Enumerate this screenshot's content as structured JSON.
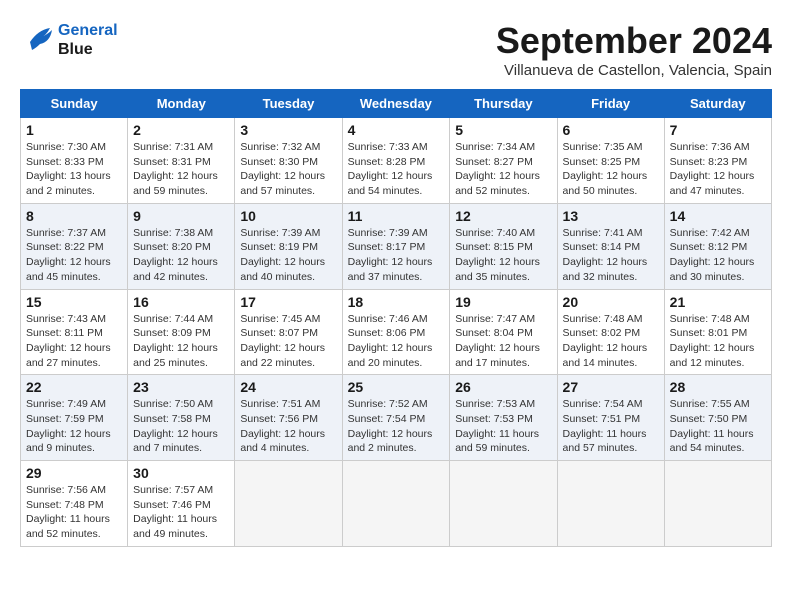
{
  "header": {
    "logo_line1": "General",
    "logo_line2": "Blue",
    "month_title": "September 2024",
    "location": "Villanueva de Castellon, Valencia, Spain"
  },
  "days_of_week": [
    "Sunday",
    "Monday",
    "Tuesday",
    "Wednesday",
    "Thursday",
    "Friday",
    "Saturday"
  ],
  "weeks": [
    {
      "days": [
        {
          "num": "",
          "empty": true
        },
        {
          "num": "",
          "empty": true
        },
        {
          "num": "",
          "empty": true
        },
        {
          "num": "",
          "empty": true
        },
        {
          "num": "",
          "empty": true
        },
        {
          "num": "",
          "empty": true
        },
        {
          "num": "1",
          "sunrise": "Sunrise: 7:36 AM",
          "sunset": "Sunset: 8:23 PM",
          "daylight": "Daylight: 12 hours and 47 minutes."
        }
      ]
    },
    {
      "days": [
        {
          "num": "2",
          "sunrise": "Sunrise: 7:31 AM",
          "sunset": "Sunset: 8:33 PM",
          "daylight": "Daylight: 13 hours and 2 minutes."
        },
        {
          "num": "3",
          "sunrise": "Sunrise: 7:32 AM",
          "sunset": "Sunset: 8:30 PM",
          "daylight": "Daylight: 12 hours and 57 minutes."
        },
        {
          "num": "4",
          "sunrise": "Sunrise: 7:33 AM",
          "sunset": "Sunset: 8:28 PM",
          "daylight": "Daylight: 12 hours and 54 minutes."
        },
        {
          "num": "5",
          "sunrise": "Sunrise: 7:34 AM",
          "sunset": "Sunset: 8:27 PM",
          "daylight": "Daylight: 12 hours and 52 minutes."
        },
        {
          "num": "6",
          "sunrise": "Sunrise: 7:35 AM",
          "sunset": "Sunset: 8:25 PM",
          "daylight": "Daylight: 12 hours and 50 minutes."
        },
        {
          "num": "7",
          "sunrise": "Sunrise: 7:36 AM",
          "sunset": "Sunset: 8:23 PM",
          "daylight": "Daylight: 12 hours and 47 minutes."
        }
      ],
      "sunday": {
        "num": "1",
        "sunrise": "Sunrise: 7:30 AM",
        "sunset": "Sunset: 8:33 PM",
        "daylight": "Daylight: 13 hours and 2 minutes."
      }
    },
    {
      "days": [
        {
          "num": "8",
          "sunrise": "Sunrise: 7:37 AM",
          "sunset": "Sunset: 8:22 PM",
          "daylight": "Daylight: 12 hours and 45 minutes."
        },
        {
          "num": "9",
          "sunrise": "Sunrise: 7:38 AM",
          "sunset": "Sunset: 8:20 PM",
          "daylight": "Daylight: 12 hours and 42 minutes."
        },
        {
          "num": "10",
          "sunrise": "Sunrise: 7:39 AM",
          "sunset": "Sunset: 8:19 PM",
          "daylight": "Daylight: 12 hours and 40 minutes."
        },
        {
          "num": "11",
          "sunrise": "Sunrise: 7:39 AM",
          "sunset": "Sunset: 8:17 PM",
          "daylight": "Daylight: 12 hours and 37 minutes."
        },
        {
          "num": "12",
          "sunrise": "Sunrise: 7:40 AM",
          "sunset": "Sunset: 8:15 PM",
          "daylight": "Daylight: 12 hours and 35 minutes."
        },
        {
          "num": "13",
          "sunrise": "Sunrise: 7:41 AM",
          "sunset": "Sunset: 8:14 PM",
          "daylight": "Daylight: 12 hours and 32 minutes."
        },
        {
          "num": "14",
          "sunrise": "Sunrise: 7:42 AM",
          "sunset": "Sunset: 8:12 PM",
          "daylight": "Daylight: 12 hours and 30 minutes."
        }
      ]
    },
    {
      "days": [
        {
          "num": "15",
          "sunrise": "Sunrise: 7:43 AM",
          "sunset": "Sunset: 8:11 PM",
          "daylight": "Daylight: 12 hours and 27 minutes."
        },
        {
          "num": "16",
          "sunrise": "Sunrise: 7:44 AM",
          "sunset": "Sunset: 8:09 PM",
          "daylight": "Daylight: 12 hours and 25 minutes."
        },
        {
          "num": "17",
          "sunrise": "Sunrise: 7:45 AM",
          "sunset": "Sunset: 8:07 PM",
          "daylight": "Daylight: 12 hours and 22 minutes."
        },
        {
          "num": "18",
          "sunrise": "Sunrise: 7:46 AM",
          "sunset": "Sunset: 8:06 PM",
          "daylight": "Daylight: 12 hours and 20 minutes."
        },
        {
          "num": "19",
          "sunrise": "Sunrise: 7:47 AM",
          "sunset": "Sunset: 8:04 PM",
          "daylight": "Daylight: 12 hours and 17 minutes."
        },
        {
          "num": "20",
          "sunrise": "Sunrise: 7:48 AM",
          "sunset": "Sunset: 8:02 PM",
          "daylight": "Daylight: 12 hours and 14 minutes."
        },
        {
          "num": "21",
          "sunrise": "Sunrise: 7:48 AM",
          "sunset": "Sunset: 8:01 PM",
          "daylight": "Daylight: 12 hours and 12 minutes."
        }
      ]
    },
    {
      "days": [
        {
          "num": "22",
          "sunrise": "Sunrise: 7:49 AM",
          "sunset": "Sunset: 7:59 PM",
          "daylight": "Daylight: 12 hours and 9 minutes."
        },
        {
          "num": "23",
          "sunrise": "Sunrise: 7:50 AM",
          "sunset": "Sunset: 7:58 PM",
          "daylight": "Daylight: 12 hours and 7 minutes."
        },
        {
          "num": "24",
          "sunrise": "Sunrise: 7:51 AM",
          "sunset": "Sunset: 7:56 PM",
          "daylight": "Daylight: 12 hours and 4 minutes."
        },
        {
          "num": "25",
          "sunrise": "Sunrise: 7:52 AM",
          "sunset": "Sunset: 7:54 PM",
          "daylight": "Daylight: 12 hours and 2 minutes."
        },
        {
          "num": "26",
          "sunrise": "Sunrise: 7:53 AM",
          "sunset": "Sunset: 7:53 PM",
          "daylight": "Daylight: 11 hours and 59 minutes."
        },
        {
          "num": "27",
          "sunrise": "Sunrise: 7:54 AM",
          "sunset": "Sunset: 7:51 PM",
          "daylight": "Daylight: 11 hours and 57 minutes."
        },
        {
          "num": "28",
          "sunrise": "Sunrise: 7:55 AM",
          "sunset": "Sunset: 7:50 PM",
          "daylight": "Daylight: 11 hours and 54 minutes."
        }
      ]
    },
    {
      "days": [
        {
          "num": "29",
          "sunrise": "Sunrise: 7:56 AM",
          "sunset": "Sunset: 7:48 PM",
          "daylight": "Daylight: 11 hours and 52 minutes."
        },
        {
          "num": "30",
          "sunrise": "Sunrise: 7:57 AM",
          "sunset": "Sunset: 7:46 PM",
          "daylight": "Daylight: 11 hours and 49 minutes."
        },
        {
          "num": "",
          "empty": true
        },
        {
          "num": "",
          "empty": true
        },
        {
          "num": "",
          "empty": true
        },
        {
          "num": "",
          "empty": true
        },
        {
          "num": "",
          "empty": true
        }
      ]
    }
  ]
}
